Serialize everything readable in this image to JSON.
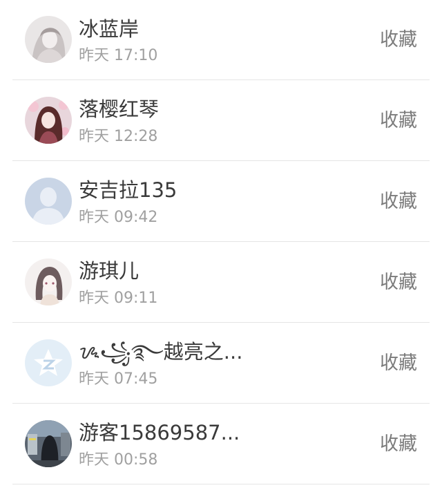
{
  "items": [
    {
      "name": "冰蓝岸",
      "time": "昨天 17:10",
      "action": "收藏",
      "avatar_icon": "girl-sketch-avatar-icon"
    },
    {
      "name": "落樱红琴",
      "time": "昨天 12:28",
      "action": "收藏",
      "avatar_icon": "anime-girl-avatar-icon"
    },
    {
      "name": "安吉拉135",
      "time": "昨天 09:42",
      "action": "收藏",
      "avatar_icon": "default-user-avatar-icon"
    },
    {
      "name": "游琪儿",
      "time": "昨天 09:11",
      "action": "收藏",
      "avatar_icon": "anime-girl-avatar-icon"
    },
    {
      "name": "ᝰ꧁࿐越亮之...",
      "time": "昨天 07:45",
      "action": "收藏",
      "avatar_icon": "qzone-star-avatar-icon"
    },
    {
      "name": "游客15869587...",
      "time": "昨天 00:58",
      "action": "收藏",
      "avatar_icon": "dark-figure-avatar-icon"
    }
  ],
  "colors": {
    "name_text": "#3a3a3a",
    "time_text": "#a0a0a0",
    "action_text": "#7b7b7b",
    "divider": "#e5e5e5"
  }
}
